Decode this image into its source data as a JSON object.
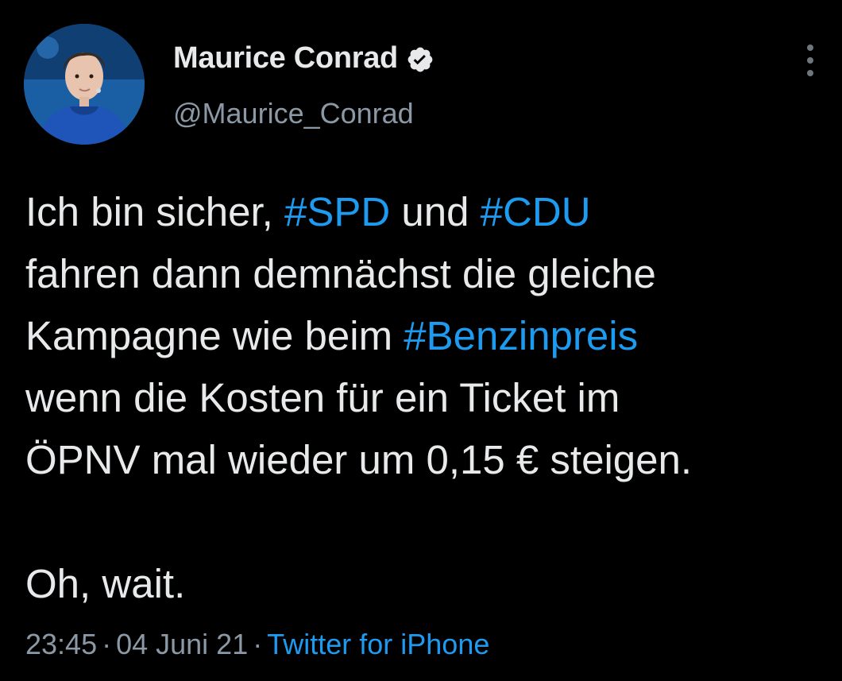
{
  "author": {
    "name": "Maurice Conrad",
    "handle": "@Maurice_Conrad",
    "verified": true,
    "avatar_icon": "profile-photo"
  },
  "tweet": {
    "lines": [
      [
        {
          "text": "Ich bin sicher, ",
          "hashtag": false
        },
        {
          "text": "#SPD",
          "hashtag": true
        },
        {
          "text": " und ",
          "hashtag": false
        },
        {
          "text": "#CDU",
          "hashtag": true
        }
      ],
      [
        {
          "text": "fahren dann demnächst die gleiche",
          "hashtag": false
        }
      ],
      [
        {
          "text": "Kampagne wie beim ",
          "hashtag": false
        },
        {
          "text": "#Benzinpreis",
          "hashtag": true
        }
      ],
      [
        {
          "text": "wenn die Kosten für ein Ticket im",
          "hashtag": false
        }
      ],
      [
        {
          "text": "ÖPNV mal wieder um 0,15 € steigen.",
          "hashtag": false
        }
      ],
      [],
      [
        {
          "text": "Oh, wait.",
          "hashtag": false
        }
      ]
    ]
  },
  "meta": {
    "time": "23:45",
    "separator": "·",
    "date": "04 Juni 21",
    "source": "Twitter for iPhone"
  },
  "colors": {
    "background": "#000000",
    "text": "#e7e9ea",
    "secondary": "#8b98a5",
    "link": "#1d9bf0"
  },
  "icons": {
    "verified": "verified-badge-icon",
    "more": "more-vertical-icon"
  }
}
